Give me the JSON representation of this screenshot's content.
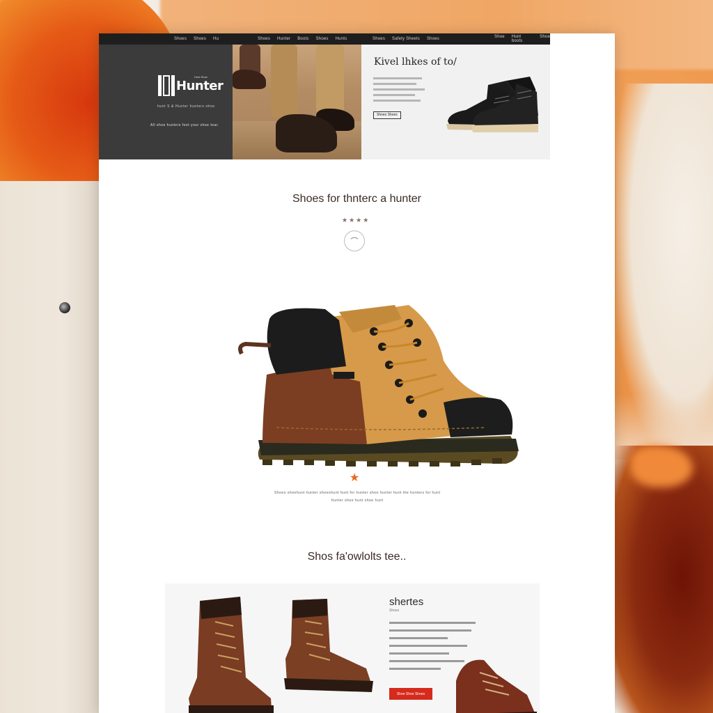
{
  "nav": {
    "left_links": [
      "Shoes",
      "Shoes",
      "Hu"
    ],
    "mid_links": [
      "Shoes",
      "Hunter",
      "Boots",
      "Shoes",
      "Hunts"
    ],
    "mid2_links": [
      "Shoes",
      "Safety Sheets",
      "Shoes"
    ],
    "right_links": [
      "Shoe",
      "Hunt boots",
      "Shoe"
    ]
  },
  "hero": {
    "logo_text": "Hunter",
    "logo_small": "Hunt Shoe",
    "tagline": "hunt S & Hunter hunters shoe",
    "subtag": "All shoe hunters foot your shoe tear.",
    "right_title": "Kivel lhkes of to/",
    "button_label": "Shoes Shoes"
  },
  "section1": {
    "title": "Shoes for thnterc a hunter",
    "stars": "★★★★",
    "desc_line1": "Shoes shoehunt hunter shoeshunt hunt for hunter shoe hunter hunt the hunters for hunt",
    "desc_line2": "hunter shoe hunt shoe hunt"
  },
  "section2": {
    "title": "Shos fa'owlolts tee..",
    "panel_title": "shertes",
    "panel_sub": "Shoes",
    "button_label": "Shoe Shoe Shoes"
  },
  "colors": {
    "accent": "#d62a1c",
    "nav_bg": "#1e1e1e",
    "hero_dark": "#3b3b3b",
    "star": "#e8681c"
  },
  "icons": [
    "logo-mark-icon",
    "stars-icon",
    "emblem-icon",
    "star-icon"
  ]
}
